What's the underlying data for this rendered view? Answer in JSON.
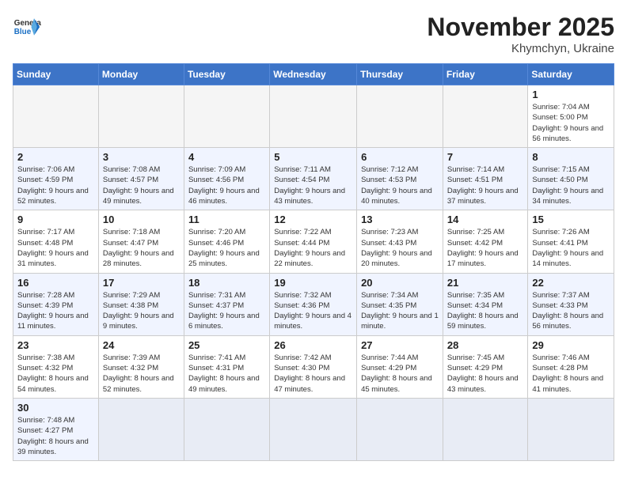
{
  "header": {
    "logo_general": "General",
    "logo_blue": "Blue",
    "month_title": "November 2025",
    "location": "Khymchyn, Ukraine"
  },
  "weekdays": [
    "Sunday",
    "Monday",
    "Tuesday",
    "Wednesday",
    "Thursday",
    "Friday",
    "Saturday"
  ],
  "weeks": [
    [
      {
        "day": "",
        "info": ""
      },
      {
        "day": "",
        "info": ""
      },
      {
        "day": "",
        "info": ""
      },
      {
        "day": "",
        "info": ""
      },
      {
        "day": "",
        "info": ""
      },
      {
        "day": "",
        "info": ""
      },
      {
        "day": "1",
        "info": "Sunrise: 7:04 AM\nSunset: 5:00 PM\nDaylight: 9 hours and 56 minutes."
      }
    ],
    [
      {
        "day": "2",
        "info": "Sunrise: 7:06 AM\nSunset: 4:59 PM\nDaylight: 9 hours and 52 minutes."
      },
      {
        "day": "3",
        "info": "Sunrise: 7:08 AM\nSunset: 4:57 PM\nDaylight: 9 hours and 49 minutes."
      },
      {
        "day": "4",
        "info": "Sunrise: 7:09 AM\nSunset: 4:56 PM\nDaylight: 9 hours and 46 minutes."
      },
      {
        "day": "5",
        "info": "Sunrise: 7:11 AM\nSunset: 4:54 PM\nDaylight: 9 hours and 43 minutes."
      },
      {
        "day": "6",
        "info": "Sunrise: 7:12 AM\nSunset: 4:53 PM\nDaylight: 9 hours and 40 minutes."
      },
      {
        "day": "7",
        "info": "Sunrise: 7:14 AM\nSunset: 4:51 PM\nDaylight: 9 hours and 37 minutes."
      },
      {
        "day": "8",
        "info": "Sunrise: 7:15 AM\nSunset: 4:50 PM\nDaylight: 9 hours and 34 minutes."
      }
    ],
    [
      {
        "day": "9",
        "info": "Sunrise: 7:17 AM\nSunset: 4:48 PM\nDaylight: 9 hours and 31 minutes."
      },
      {
        "day": "10",
        "info": "Sunrise: 7:18 AM\nSunset: 4:47 PM\nDaylight: 9 hours and 28 minutes."
      },
      {
        "day": "11",
        "info": "Sunrise: 7:20 AM\nSunset: 4:46 PM\nDaylight: 9 hours and 25 minutes."
      },
      {
        "day": "12",
        "info": "Sunrise: 7:22 AM\nSunset: 4:44 PM\nDaylight: 9 hours and 22 minutes."
      },
      {
        "day": "13",
        "info": "Sunrise: 7:23 AM\nSunset: 4:43 PM\nDaylight: 9 hours and 20 minutes."
      },
      {
        "day": "14",
        "info": "Sunrise: 7:25 AM\nSunset: 4:42 PM\nDaylight: 9 hours and 17 minutes."
      },
      {
        "day": "15",
        "info": "Sunrise: 7:26 AM\nSunset: 4:41 PM\nDaylight: 9 hours and 14 minutes."
      }
    ],
    [
      {
        "day": "16",
        "info": "Sunrise: 7:28 AM\nSunset: 4:39 PM\nDaylight: 9 hours and 11 minutes."
      },
      {
        "day": "17",
        "info": "Sunrise: 7:29 AM\nSunset: 4:38 PM\nDaylight: 9 hours and 9 minutes."
      },
      {
        "day": "18",
        "info": "Sunrise: 7:31 AM\nSunset: 4:37 PM\nDaylight: 9 hours and 6 minutes."
      },
      {
        "day": "19",
        "info": "Sunrise: 7:32 AM\nSunset: 4:36 PM\nDaylight: 9 hours and 4 minutes."
      },
      {
        "day": "20",
        "info": "Sunrise: 7:34 AM\nSunset: 4:35 PM\nDaylight: 9 hours and 1 minute."
      },
      {
        "day": "21",
        "info": "Sunrise: 7:35 AM\nSunset: 4:34 PM\nDaylight: 8 hours and 59 minutes."
      },
      {
        "day": "22",
        "info": "Sunrise: 7:37 AM\nSunset: 4:33 PM\nDaylight: 8 hours and 56 minutes."
      }
    ],
    [
      {
        "day": "23",
        "info": "Sunrise: 7:38 AM\nSunset: 4:32 PM\nDaylight: 8 hours and 54 minutes."
      },
      {
        "day": "24",
        "info": "Sunrise: 7:39 AM\nSunset: 4:32 PM\nDaylight: 8 hours and 52 minutes."
      },
      {
        "day": "25",
        "info": "Sunrise: 7:41 AM\nSunset: 4:31 PM\nDaylight: 8 hours and 49 minutes."
      },
      {
        "day": "26",
        "info": "Sunrise: 7:42 AM\nSunset: 4:30 PM\nDaylight: 8 hours and 47 minutes."
      },
      {
        "day": "27",
        "info": "Sunrise: 7:44 AM\nSunset: 4:29 PM\nDaylight: 8 hours and 45 minutes."
      },
      {
        "day": "28",
        "info": "Sunrise: 7:45 AM\nSunset: 4:29 PM\nDaylight: 8 hours and 43 minutes."
      },
      {
        "day": "29",
        "info": "Sunrise: 7:46 AM\nSunset: 4:28 PM\nDaylight: 8 hours and 41 minutes."
      }
    ],
    [
      {
        "day": "30",
        "info": "Sunrise: 7:48 AM\nSunset: 4:27 PM\nDaylight: 8 hours and 39 minutes."
      },
      {
        "day": "",
        "info": ""
      },
      {
        "day": "",
        "info": ""
      },
      {
        "day": "",
        "info": ""
      },
      {
        "day": "",
        "info": ""
      },
      {
        "day": "",
        "info": ""
      },
      {
        "day": "",
        "info": ""
      }
    ]
  ]
}
